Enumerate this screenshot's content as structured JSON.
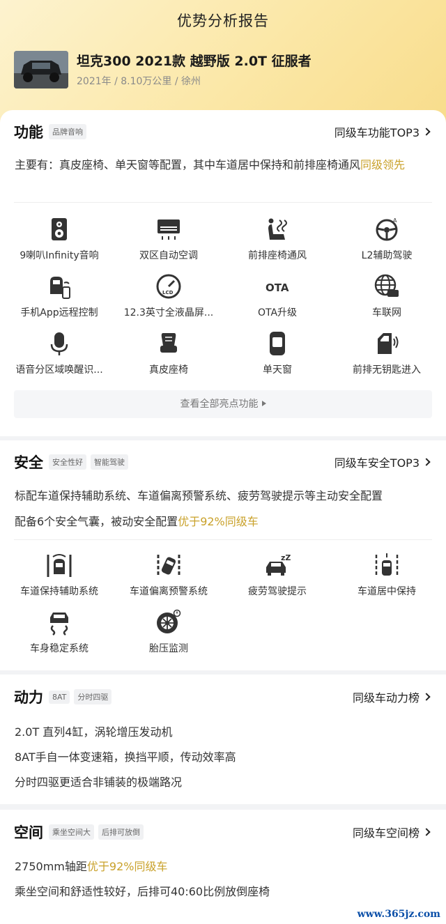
{
  "header": {
    "title": "优势分析报告",
    "car_name": "坦克300 2021款 越野版 2.0T 征服者",
    "car_meta": "2021年 / 8.10万公里 / 徐州"
  },
  "function": {
    "title": "功能",
    "tags": [
      "品牌音响"
    ],
    "link": "同级车功能TOP3",
    "desc_main": "主要有：真皮座椅、单天窗等配置，其中车道居中保持和前排座椅通风",
    "desc_hl": "同级领先",
    "features": [
      {
        "label": "9喇叭Infinity音响",
        "icon": "speaker-icon"
      },
      {
        "label": "双区自动空调",
        "icon": "air-conditioner-icon"
      },
      {
        "label": "前排座椅通风",
        "icon": "seat-ventilation-icon"
      },
      {
        "label": "L2辅助驾驶",
        "icon": "assisted-driving-icon"
      },
      {
        "label": "手机App远程控制",
        "icon": "phone-remote-icon"
      },
      {
        "label": "12.3英寸全液晶屏...",
        "icon": "lcd-icon"
      },
      {
        "label": "OTA升级",
        "icon": "ota-icon"
      },
      {
        "label": "车联网",
        "icon": "connected-car-icon"
      },
      {
        "label": "语音分区域唤醒识...",
        "icon": "microphone-icon"
      },
      {
        "label": "真皮座椅",
        "icon": "leather-seat-icon"
      },
      {
        "label": "单天窗",
        "icon": "sunroof-icon"
      },
      {
        "label": "前排无钥匙进入",
        "icon": "keyless-entry-icon"
      }
    ],
    "more": "查看全部亮点功能",
    "ota_text": "OTA",
    "lcd_text": "LCD"
  },
  "safety": {
    "title": "安全",
    "tags": [
      "安全性好",
      "智能驾驶"
    ],
    "link": "同级车安全TOP3",
    "line1": "标配车道保持辅助系统、车道偏离预警系统、疲劳驾驶提示等主动安全配置",
    "line2_main": "配备6个安全气囊，被动安全配置",
    "line2_hl": "优于92%同级车",
    "features": [
      {
        "label": "车道保持辅助系统",
        "icon": "lane-keep-icon"
      },
      {
        "label": "车道偏离预警系统",
        "icon": "lane-departure-icon"
      },
      {
        "label": "疲劳驾驶提示",
        "icon": "fatigue-alert-icon"
      },
      {
        "label": "车道居中保持",
        "icon": "lane-center-icon"
      },
      {
        "label": "车身稳定系统",
        "icon": "stability-control-icon"
      },
      {
        "label": "胎压监测",
        "icon": "tire-pressure-icon"
      }
    ],
    "zz_text": "zZ"
  },
  "power": {
    "title": "动力",
    "tags": [
      "8AT",
      "分时四驱"
    ],
    "link": "同级车动力榜",
    "lines": [
      "2.0T 直列4缸，涡轮增压发动机",
      "8AT手自一体变速箱，换挡平顺，传动效率高",
      "分时四驱更适合非铺装的极端路况"
    ]
  },
  "space": {
    "title": "空间",
    "tags": [
      "乘坐空间大",
      "后排可放倒"
    ],
    "link": "同级车空间榜",
    "line1_main": "2750mm轴距",
    "line1_hl": "优于92%同级车",
    "line2": "乘坐空间和舒适性较好，后排可40:60比例放倒座椅"
  },
  "watermark": "www.365jz.com",
  "colors": {
    "accent": "#c9a12a",
    "hero_bg": "#fbe7a6"
  }
}
